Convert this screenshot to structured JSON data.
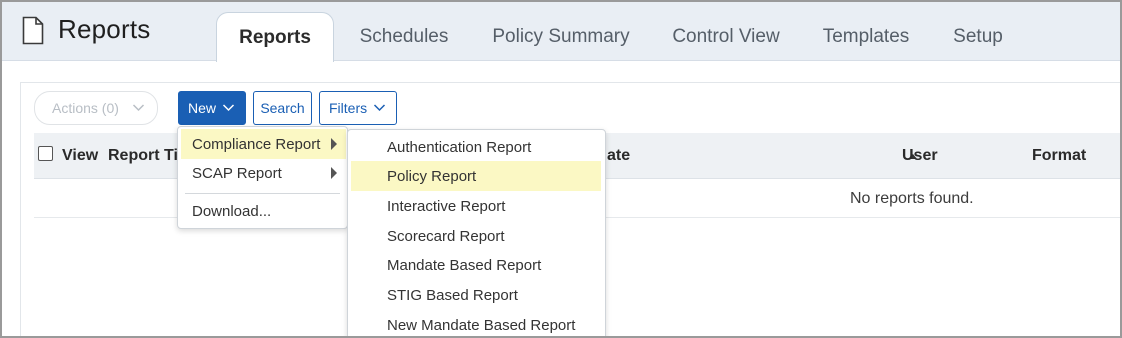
{
  "header": {
    "title": "Reports",
    "tabs": [
      {
        "label": "Reports",
        "active": true
      },
      {
        "label": "Schedules",
        "active": false
      },
      {
        "label": "Policy Summary",
        "active": false
      },
      {
        "label": "Control View",
        "active": false
      },
      {
        "label": "Templates",
        "active": false
      },
      {
        "label": "Setup",
        "active": false
      }
    ]
  },
  "toolbar": {
    "actions_label": "Actions (0)",
    "new_label": "New",
    "search_label": "Search",
    "filters_label": "Filters"
  },
  "table": {
    "columns": [
      "View",
      "Report Ti",
      "ate",
      "User",
      "Format"
    ],
    "sort_column": "User",
    "empty_message": "No reports found."
  },
  "new_menu": {
    "items": [
      {
        "label": "Compliance Report",
        "has_submenu": true,
        "highlighted": true
      },
      {
        "label": "SCAP Report",
        "has_submenu": true,
        "highlighted": false
      },
      {
        "label": "Download...",
        "has_submenu": false,
        "highlighted": false
      }
    ]
  },
  "compliance_submenu": {
    "items": [
      {
        "label": "Authentication Report",
        "highlighted": false
      },
      {
        "label": "Policy Report",
        "highlighted": true
      },
      {
        "label": "Interactive Report",
        "highlighted": false
      },
      {
        "label": "Scorecard Report",
        "highlighted": false
      },
      {
        "label": "Mandate Based Report",
        "highlighted": false
      },
      {
        "label": "STIG Based Report",
        "highlighted": false
      },
      {
        "label": "New Mandate Based Report",
        "highlighted": false
      }
    ]
  },
  "colors": {
    "primary": "#1a5fb4",
    "header_bg": "#e9eef4",
    "highlight": "#fbf8c4"
  },
  "icons": {
    "page": "document-icon",
    "chevron": "chevron-down-icon",
    "submenu_arrow": "caret-right-icon",
    "sort": "sort-ascending-icon"
  }
}
